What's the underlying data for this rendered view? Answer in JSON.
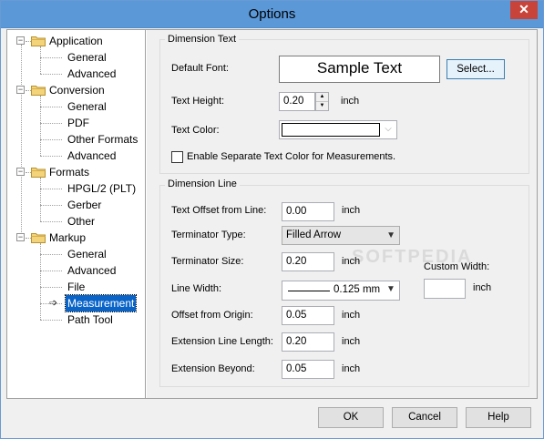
{
  "window": {
    "title": "Options",
    "close_symbol": "✕"
  },
  "tree": {
    "items": [
      {
        "label": "Application",
        "level": 0
      },
      {
        "label": "General",
        "level": 1
      },
      {
        "label": "Advanced",
        "level": 1
      },
      {
        "label": "Conversion",
        "level": 0
      },
      {
        "label": "General",
        "level": 1
      },
      {
        "label": "PDF",
        "level": 1
      },
      {
        "label": "Other Formats",
        "level": 1
      },
      {
        "label": "Advanced",
        "level": 1
      },
      {
        "label": "Formats",
        "level": 0
      },
      {
        "label": "HPGL/2 (PLT)",
        "level": 1
      },
      {
        "label": "Gerber",
        "level": 1
      },
      {
        "label": "Other",
        "level": 1
      },
      {
        "label": "Markup",
        "level": 0
      },
      {
        "label": "General",
        "level": 1
      },
      {
        "label": "Advanced",
        "level": 1
      },
      {
        "label": "File",
        "level": 1
      },
      {
        "label": "Measurement",
        "level": 1,
        "selected": true
      },
      {
        "label": "Path Tool",
        "level": 1
      }
    ],
    "expand_symbol": "−"
  },
  "dimension_text": {
    "legend": "Dimension Text",
    "default_font_label": "Default Font:",
    "sample_text": "Sample Text",
    "select_button": "Select...",
    "text_height_label": "Text Height:",
    "text_height_value": "0.20",
    "text_height_unit": "inch",
    "text_color_label": "Text Color:",
    "separate_color_label": "Enable Separate Text Color for Measurements.",
    "separate_color_checked": false
  },
  "dimension_line": {
    "legend": "Dimension Line",
    "text_offset_label": "Text Offset from Line:",
    "text_offset_value": "0.00",
    "text_offset_unit": "inch",
    "terminator_type_label": "Terminator Type:",
    "terminator_type_value": "Filled Arrow",
    "terminator_size_label": "Terminator Size:",
    "terminator_size_value": "0.20",
    "terminator_size_unit": "inch",
    "line_width_label": "Line Width:",
    "line_width_value": "0.125 mm",
    "offset_origin_label": "Offset from Origin:",
    "offset_origin_value": "0.05",
    "offset_origin_unit": "inch",
    "extension_length_label": "Extension Line Length:",
    "extension_length_value": "0.20",
    "extension_length_unit": "inch",
    "extension_beyond_label": "Extension Beyond:",
    "extension_beyond_value": "0.05",
    "extension_beyond_unit": "inch",
    "custom_width_label": "Custom Width:",
    "custom_width_value": "",
    "custom_width_unit": "inch"
  },
  "buttons": {
    "ok": "OK",
    "cancel": "Cancel",
    "help": "Help"
  },
  "watermark": "SOFTPEDIA"
}
